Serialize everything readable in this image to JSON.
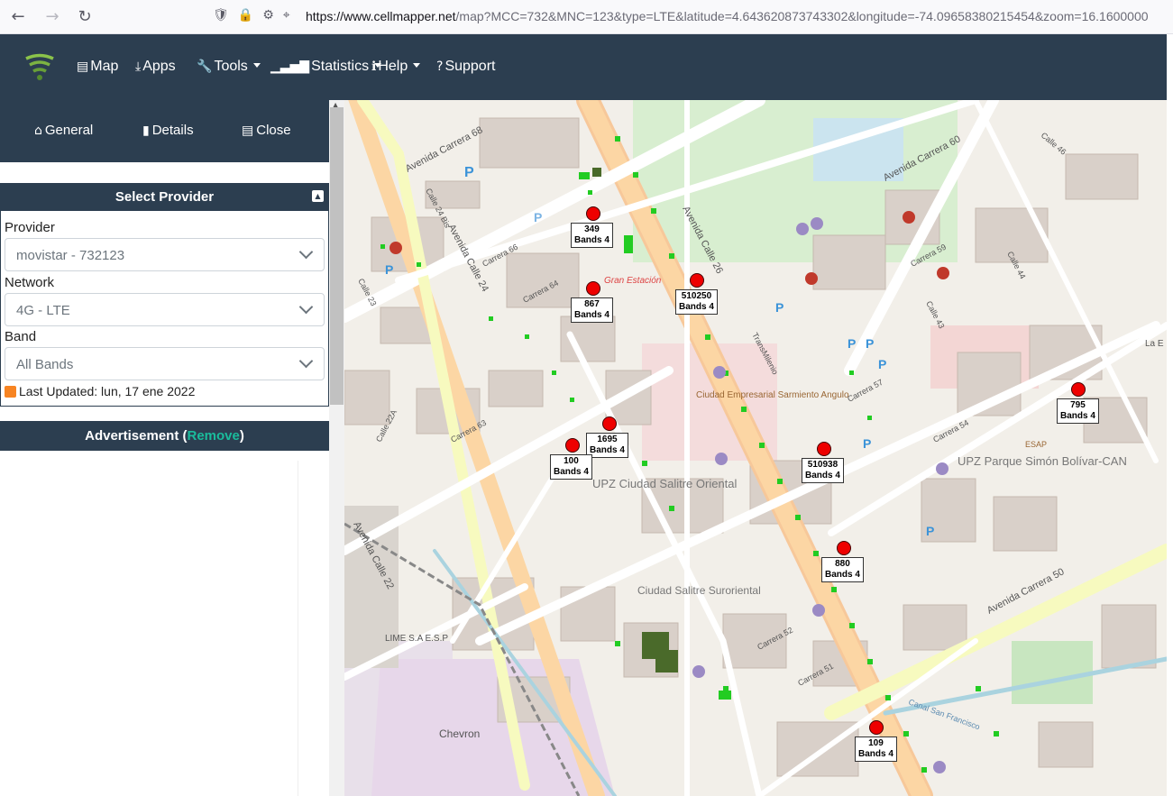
{
  "browser": {
    "url_host": "https://www.cellmapper.net",
    "url_rest": "/map?MCC=732&MNC=123&type=LTE&latitude=4.643620873743302&longitude=-74.09658380215454&zoom=16.1600000"
  },
  "nav": {
    "map": "Map",
    "apps": "Apps",
    "tools": "Tools",
    "statistics": "Statistics",
    "help": "Help",
    "support": "Support"
  },
  "side_tabs": {
    "general": "General",
    "details": "Details",
    "close": "Close"
  },
  "provider_panel": {
    "title": "Select Provider",
    "provider_label": "Provider",
    "provider_value": "movistar - 732123",
    "network_label": "Network",
    "network_value": "4G - LTE",
    "band_label": "Band",
    "band_value": "All Bands",
    "last_updated": "Last Updated: lun, 17 ene 2022"
  },
  "advertisement": {
    "label": "Advertisement (",
    "remove": "Remove",
    "close_paren": ")"
  },
  "map": {
    "towers": [
      {
        "id": "349",
        "bands": "Bands 4"
      },
      {
        "id": "867",
        "bands": "Bands 4"
      },
      {
        "id": "510250",
        "bands": "Bands 4"
      },
      {
        "id": "795",
        "bands": "Bands 4"
      },
      {
        "id": "1695",
        "bands": "Bands 4"
      },
      {
        "id": "100",
        "bands": "Bands 4"
      },
      {
        "id": "510938",
        "bands": "Bands 4"
      },
      {
        "id": "880",
        "bands": "Bands 4"
      },
      {
        "id": "109",
        "bands": "Bands 4"
      }
    ],
    "labels": {
      "avenida_carrera_68": "Avenida Carrera 68",
      "avenida_calle_24": "Avenida Calle 24",
      "avenida_calle_26": "Avenida Calle 26",
      "avenida_carrera_60": "Avenida Carrera 60",
      "avenida_carrera_50": "Avenida Carrera 50",
      "avenida_calle_22": "Avenida Calle 22",
      "gran_estacion": "Gran Estación",
      "transmilenio": "TransMilenio",
      "ciudad_empresarial": "Ciudad Empresarial Sarmiento Angulo",
      "upz_salitre": "UPZ Ciudad Salitre Oriental",
      "upz_simon": "UPZ Parque Simón Bolívar-CAN",
      "ciudad_salitre_sur": "Ciudad Salitre Suroriental",
      "lime": "LIME S.A E.S.P",
      "chevron": "Chevron",
      "canal": "Canal San Francisco",
      "esap": "ESAP",
      "la_e": "La E",
      "calle_24_bis": "Calle 24 Bis",
      "calle_22a": "Calle 22A",
      "calle_23": "Calle 23",
      "carrera_66": "Carrera 66",
      "carrera_64": "Carrera 64",
      "carrera_63": "Carrera 63",
      "carrera_59": "Carrera 59",
      "carrera_57": "Carrera 57",
      "carrera_54": "Carrera 54",
      "carrera_52": "Carrera 52",
      "carrera_51": "Carrera 51",
      "calle_44": "Calle 44",
      "calle_46": "Calle 46",
      "calle_43": "Calle 43"
    }
  }
}
